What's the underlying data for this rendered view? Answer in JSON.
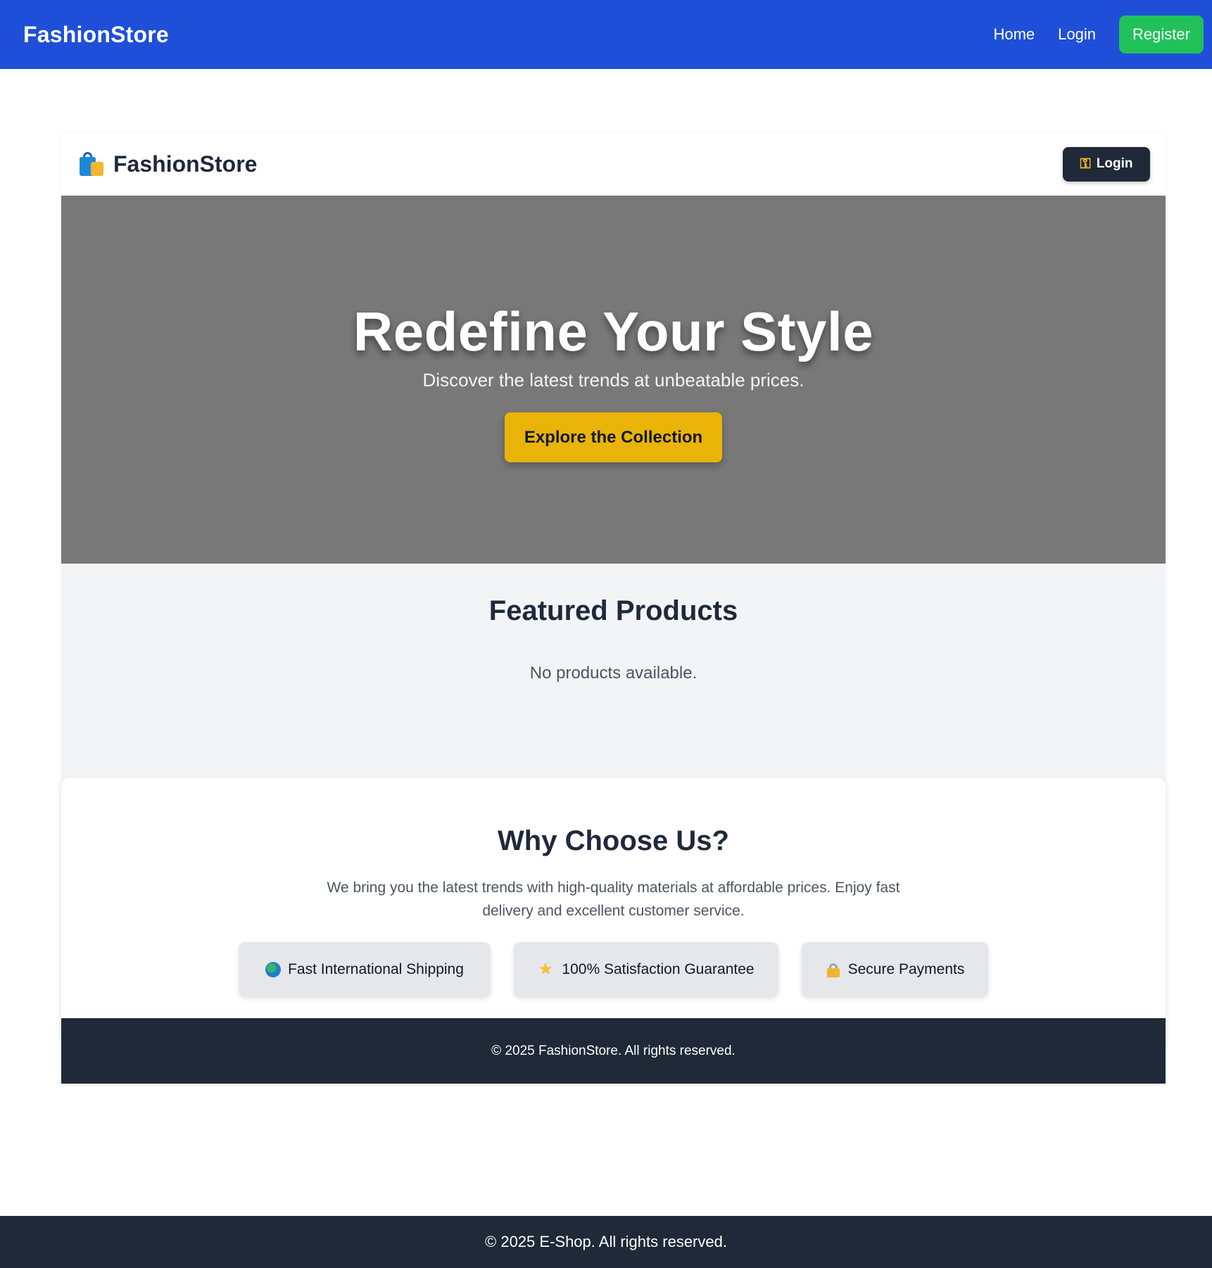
{
  "topnav": {
    "brand": "FashionStore",
    "links": [
      "Home",
      "Login"
    ],
    "register_label": "Register",
    "colors": {
      "background": "#1f4fd9",
      "register": "#21c15a"
    }
  },
  "store": {
    "header": {
      "brand": "FashionStore",
      "brand_icon": "shopping-bags-icon",
      "login_label": "Login",
      "login_icon": "key-icon"
    },
    "hero": {
      "title": "Redefine Your Style",
      "subtitle": "Discover the latest trends at unbeatable prices.",
      "cta_label": "Explore the Collection",
      "colors": {
        "background": "#787878",
        "cta": "#eab308"
      }
    },
    "featured": {
      "title": "Featured Products",
      "empty_message": "No products available."
    },
    "why": {
      "title": "Why Choose Us?",
      "text": "We bring you the latest trends with high-quality materials at affordable prices. Enjoy fast delivery and excellent customer service.",
      "features": [
        {
          "icon": "globe-icon",
          "label": "Fast International Shipping"
        },
        {
          "icon": "star-icon",
          "label": "100% Satisfaction Guarantee"
        },
        {
          "icon": "lock-icon",
          "label": "Secure Payments"
        }
      ]
    },
    "footer": {
      "text": "© 2025 FashionStore. All rights reserved."
    }
  },
  "site_footer": {
    "text": "© 2025 E-Shop. All rights reserved."
  }
}
